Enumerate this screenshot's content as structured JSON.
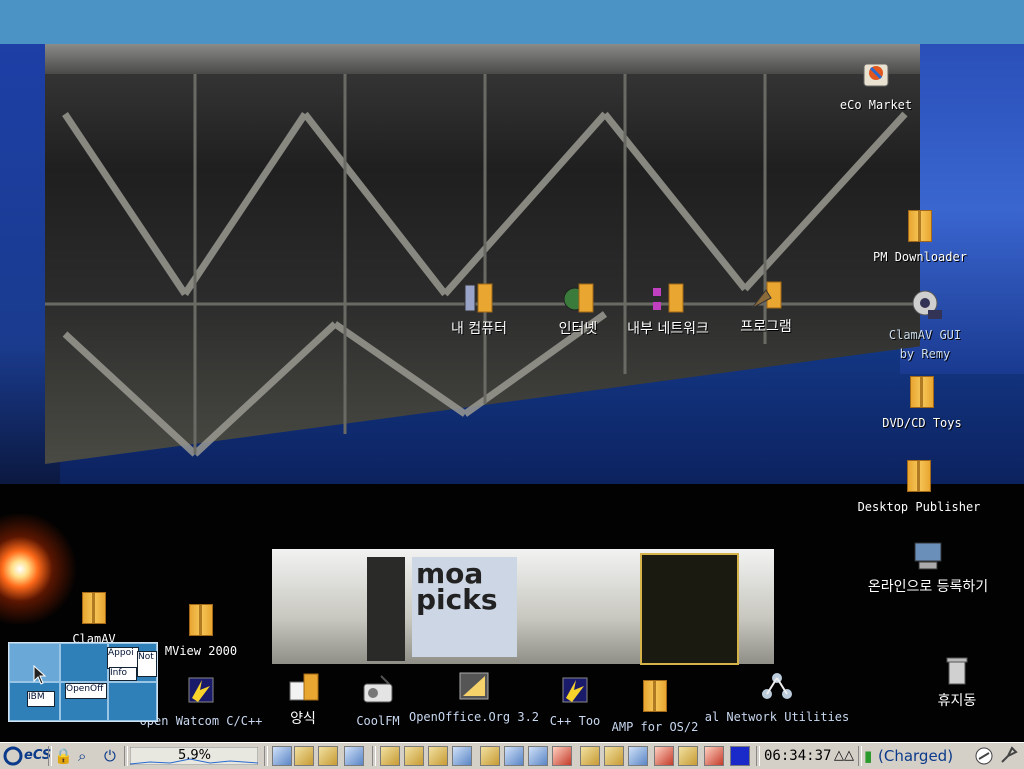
{
  "desktop": {
    "icons": [
      {
        "name": "eco-market-icon",
        "label": "eCo Market"
      },
      {
        "name": "pm-downloader-icon",
        "label": "PM Downloader"
      },
      {
        "name": "clamav-gui-icon",
        "label": "ClamAV GUI",
        "label2": "by Remy"
      },
      {
        "name": "dvd-cd-toys-icon",
        "label": "DVD/CD Toys"
      },
      {
        "name": "desktop-publisher-icon",
        "label": "Desktop Publisher"
      },
      {
        "name": "register-online-icon",
        "label": "온라인으로 등록하기"
      },
      {
        "name": "trash-icon",
        "label": "휴지동"
      },
      {
        "name": "my-computer-icon",
        "label": "내 컴퓨터"
      },
      {
        "name": "internet-icon",
        "label": "인터넷"
      },
      {
        "name": "local-network-icon",
        "label": "내부 네트워크"
      },
      {
        "name": "programs-icon",
        "label": "프로그램"
      },
      {
        "name": "clamav-icon",
        "label": "ClamAV"
      },
      {
        "name": "mview-icon",
        "label": "MView 2000"
      },
      {
        "name": "open-watcom-icon",
        "label": "Open Watcom C/C++"
      },
      {
        "name": "templates-icon",
        "label": "양식"
      },
      {
        "name": "coolfm-icon",
        "label": "CoolFM"
      },
      {
        "name": "openoffice-icon",
        "label": "OpenOffice.Org 3.2"
      },
      {
        "name": "cpp-tools-icon",
        "label": "C++ Too"
      },
      {
        "name": "amp-icon",
        "label": "AMP for OS/2"
      },
      {
        "name": "network-utilities-icon",
        "label": "al Network Utilities"
      }
    ],
    "poster": {
      "text1": "moa",
      "text2": "picks"
    }
  },
  "pager": {
    "windows": [
      "Appoi",
      "Not",
      "Info",
      "IBM",
      "OpenOff"
    ]
  },
  "taskbar": {
    "logo": "eCS",
    "cpu": "5.9%",
    "clock": "06:34:37",
    "battery": "(Charged)"
  },
  "colors": {
    "titlebar": "#4b93c4",
    "taskbar": "#d4d0c8",
    "accent": "#0b3a8a"
  }
}
